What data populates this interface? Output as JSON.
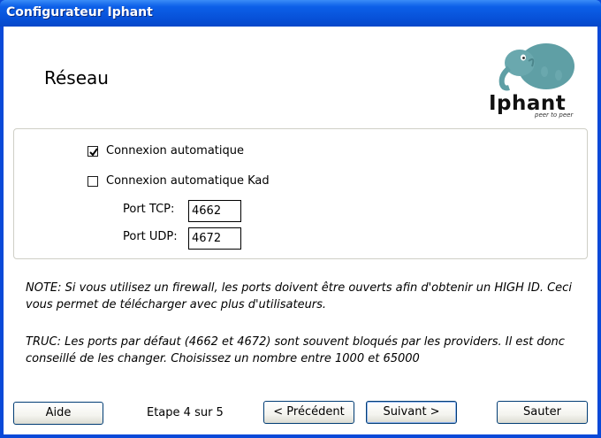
{
  "window": {
    "title": "Configurateur Iphant"
  },
  "header": {
    "title": "Réseau"
  },
  "logo": {
    "name": "Iphant",
    "tagline": "peer to peer"
  },
  "options": {
    "auto_connect": {
      "label": "Connexion automatique",
      "checked": true
    },
    "auto_connect_kad": {
      "label": "Connexion automatique Kad",
      "checked": false
    },
    "port_tcp": {
      "label": "Port TCP:",
      "value": "4662"
    },
    "port_udp": {
      "label": "Port UDP:",
      "value": "4672"
    }
  },
  "notes": {
    "note": "NOTE: Si vous utilisez un firewall, les ports doivent être ouverts afin d'obtenir un HIGH ID. Ceci vous permet de télécharger avec plus d'utilisateurs.",
    "tip": "TRUC: Les ports par défaut (4662 et 4672) sont souvent bloqués par les providers. Il est donc conseillé de les changer. Choisissez un nombre entre 1000 et 65000"
  },
  "footer": {
    "help_label": "Aide",
    "step_text": "Etape 4 sur 5",
    "prev_label": "< Précédent",
    "next_label": "Suivant >",
    "skip_label": "Sauter"
  },
  "colors": {
    "titlebar": "#0751d8",
    "window_bg": "#ffffff"
  }
}
